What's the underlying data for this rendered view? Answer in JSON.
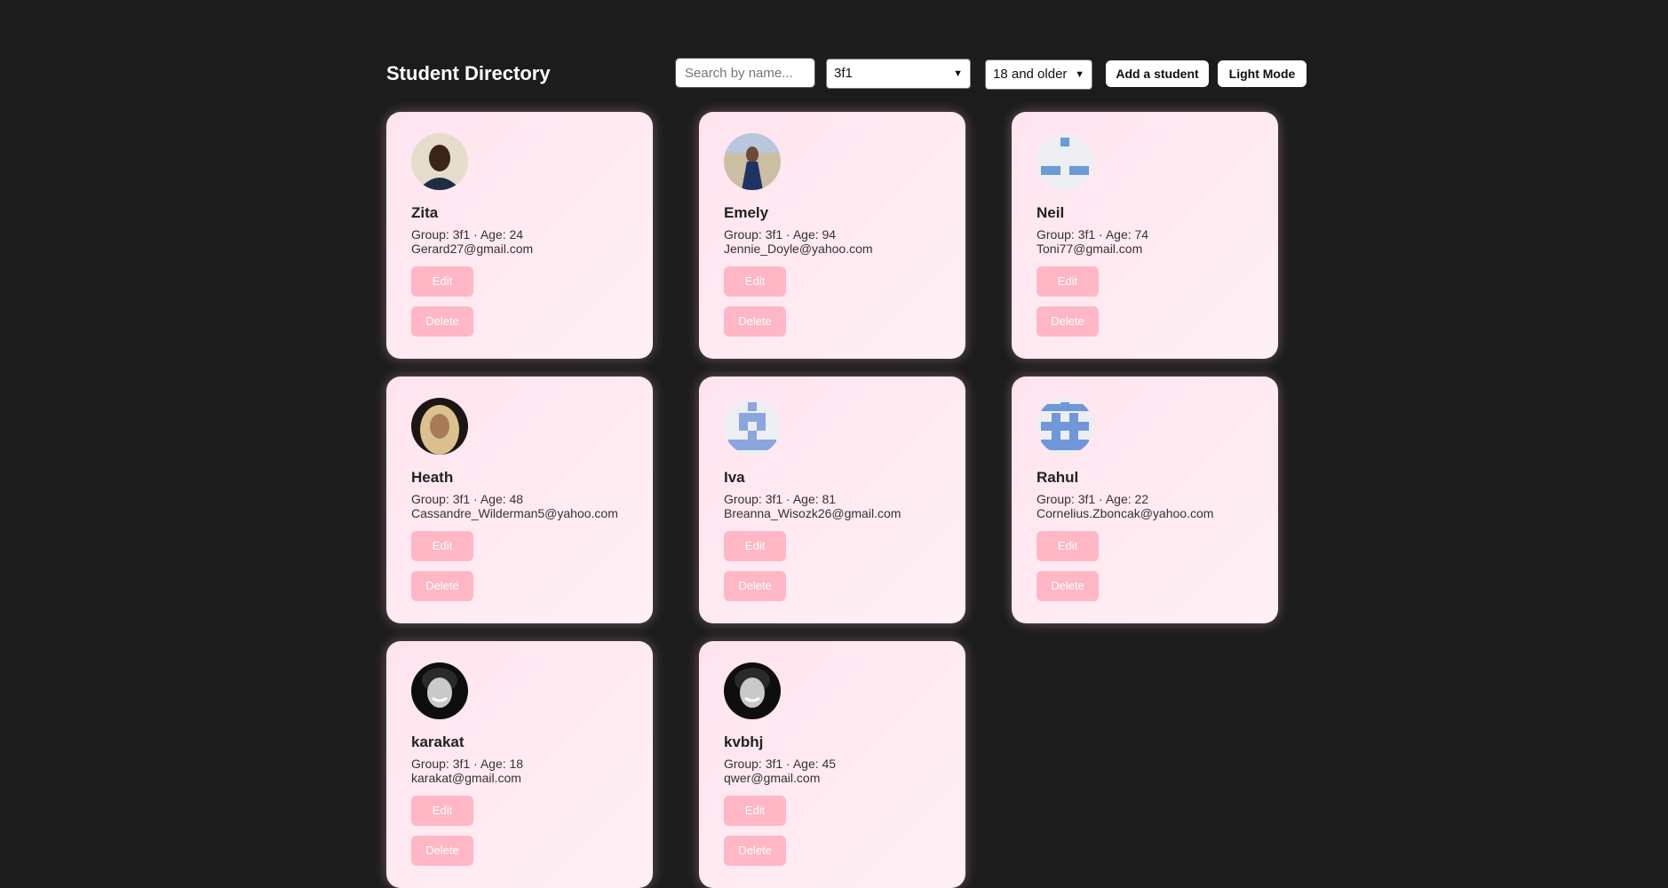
{
  "header": {
    "title": "Student Directory",
    "search_placeholder": "Search by name...",
    "group_select_value": "3f1",
    "age_select_value": "18 and older",
    "add_button_label": "Add a student",
    "mode_button_label": "Light Mode"
  },
  "card_actions": {
    "edit_label": "Edit",
    "delete_label": "Delete"
  },
  "students": [
    {
      "name": "Zita",
      "meta": "Group: 3f1 · Age: 24",
      "email": "Gerard27@gmail.com",
      "avatar": "photo-avatar-icon"
    },
    {
      "name": "Emely",
      "meta": "Group: 3f1 · Age: 94",
      "email": "Jennie_Doyle@yahoo.com",
      "avatar": "photo-avatar-icon"
    },
    {
      "name": "Neil",
      "meta": "Group: 3f1 · Age: 74",
      "email": "Toni77@gmail.com",
      "avatar": "identicon-avatar-icon"
    },
    {
      "name": "Heath",
      "meta": "Group: 3f1 · Age: 48",
      "email": "Cassandre_Wilderman5@yahoo.com",
      "avatar": "photo-avatar-icon"
    },
    {
      "name": "Iva",
      "meta": "Group: 3f1 · Age: 81",
      "email": "Breanna_Wisozk26@gmail.com",
      "avatar": "identicon-avatar-icon"
    },
    {
      "name": "Rahul",
      "meta": "Group: 3f1 · Age: 22",
      "email": "Cornelius.Zboncak@yahoo.com",
      "avatar": "identicon-avatar-icon"
    },
    {
      "name": "karakat",
      "meta": "Group: 3f1 · Age: 18",
      "email": "karakat@gmail.com",
      "avatar": "photo-avatar-icon"
    },
    {
      "name": "kvbhj",
      "meta": "Group: 3f1 · Age: 45",
      "email": "qwer@gmail.com",
      "avatar": "photo-avatar-icon"
    }
  ],
  "colors": {
    "background": "#1c1c1c",
    "card": "#ffe4ef",
    "card_button": "#ffb7c5",
    "identicon_blue": "#6a9bd6"
  }
}
